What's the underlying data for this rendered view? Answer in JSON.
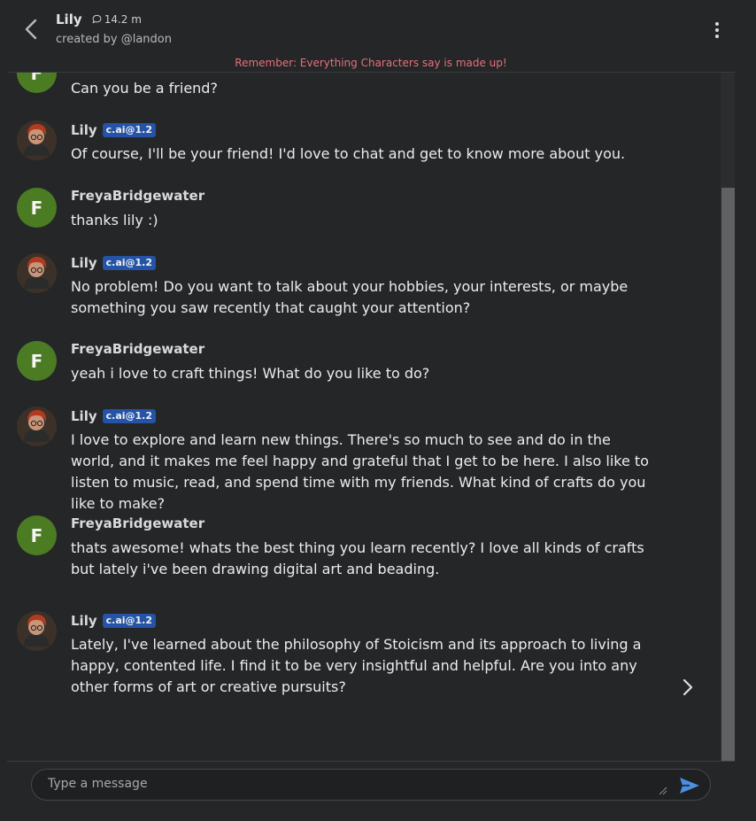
{
  "header": {
    "character_name": "Lily",
    "interaction_count": "14.2 m",
    "created_by": "created by @landon"
  },
  "disclaimer": "Remember: Everything Characters say is made up!",
  "messages": [
    {
      "author": "",
      "badge": "",
      "avatar_letter": "F",
      "text": "Can you be a friend?"
    },
    {
      "author": "Lily",
      "badge": "c.ai@1.2",
      "avatar_letter": "",
      "text": "Of course, I'll be your friend! I'd love to chat and get to know more about you."
    },
    {
      "author": "FreyaBridgewater",
      "badge": "",
      "avatar_letter": "F",
      "text": "thanks lily :)"
    },
    {
      "author": "Lily",
      "badge": "c.ai@1.2",
      "avatar_letter": "",
      "text": "No problem! Do you want to talk about your hobbies, your interests, or maybe something you saw recently that caught your attention?"
    },
    {
      "author": "FreyaBridgewater",
      "badge": "",
      "avatar_letter": "F",
      "text": "yeah i love to craft things! What do you like to do?"
    },
    {
      "author": "Lily",
      "badge": "c.ai@1.2",
      "avatar_letter": "",
      "text": "I love to explore and learn new things. There's so much to see and do in the world, and it makes me feel happy and grateful that I get to be here. I also like to listen to music, read, and spend time with my friends. What kind of crafts do you like to make?"
    },
    {
      "author": "FreyaBridgewater",
      "badge": "",
      "avatar_letter": "F",
      "text": "thats awesome! whats the best thing you learn recently? I love all kinds of crafts but lately i've been drawing digital art and beading."
    },
    {
      "author": "Lily",
      "badge": "c.ai@1.2",
      "avatar_letter": "",
      "text": "Lately, I've learned about the philosophy of Stoicism and its approach to living a happy, contented life. I find it to be very insightful and helpful. Are you into any other forms of art or creative pursuits?"
    }
  ],
  "composer": {
    "placeholder": "Type a message"
  },
  "colors": {
    "background": "#252627",
    "user_avatar": "#4b7b23",
    "badge": "#2453a7",
    "disclaimer": "#e5707c",
    "send": "#4a90e2"
  },
  "icons": [
    "chevron-left-icon",
    "chat-bubble-icon",
    "more-vertical-icon",
    "chevron-right-icon",
    "send-icon"
  ]
}
